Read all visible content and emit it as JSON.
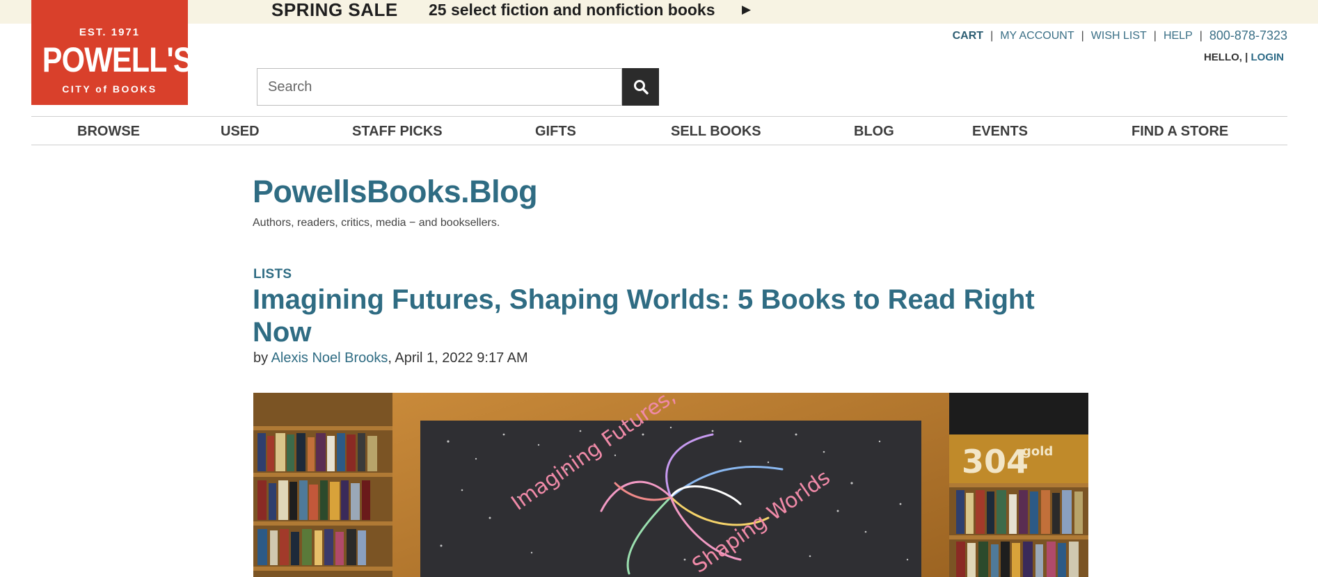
{
  "promo": {
    "title": "SPRING SALE",
    "text": "25 select fiction and nonfiction books",
    "arrow": "▶"
  },
  "logo": {
    "est": "EST. 1971",
    "name": "POWELL'S",
    "city": "CITY of BOOKS"
  },
  "utility": {
    "cart": "CART",
    "account": "MY ACCOUNT",
    "wishlist": "WISH LIST",
    "help": "HELP",
    "phone": "800-878-7323",
    "separator": "|",
    "hello": "HELLO, |",
    "login": "LOGIN"
  },
  "search": {
    "placeholder": "Search",
    "icon": "search-icon"
  },
  "nav": {
    "items": [
      {
        "label": "BROWSE"
      },
      {
        "label": "USED"
      },
      {
        "label": "STAFF PICKS"
      },
      {
        "label": "GIFTS"
      },
      {
        "label": "SELL BOOKS"
      },
      {
        "label": "BLOG"
      },
      {
        "label": "EVENTS"
      },
      {
        "label": "FIND A STORE"
      }
    ]
  },
  "blog": {
    "title": "PowellsBooks.Blog",
    "tagline": "Authors, readers, critics, media − and booksellers."
  },
  "post": {
    "category": "LISTS",
    "title": "Imagining Futures, Shaping Worlds: 5 Books to Read Right Now",
    "by": "by",
    "author": "Alexis Noel Brooks",
    "date": ", April 1, 2022 9:17 AM"
  },
  "hero": {
    "chalk_line1": "Imagining Futures,",
    "chalk_line2": "Shaping Worlds",
    "room_number": "304",
    "room_color": "gold"
  },
  "colors": {
    "accent": "#2f6c83",
    "logo": "#d9402b",
    "promo_bg": "#f7f3e3",
    "search_button": "#2b2b2b"
  }
}
